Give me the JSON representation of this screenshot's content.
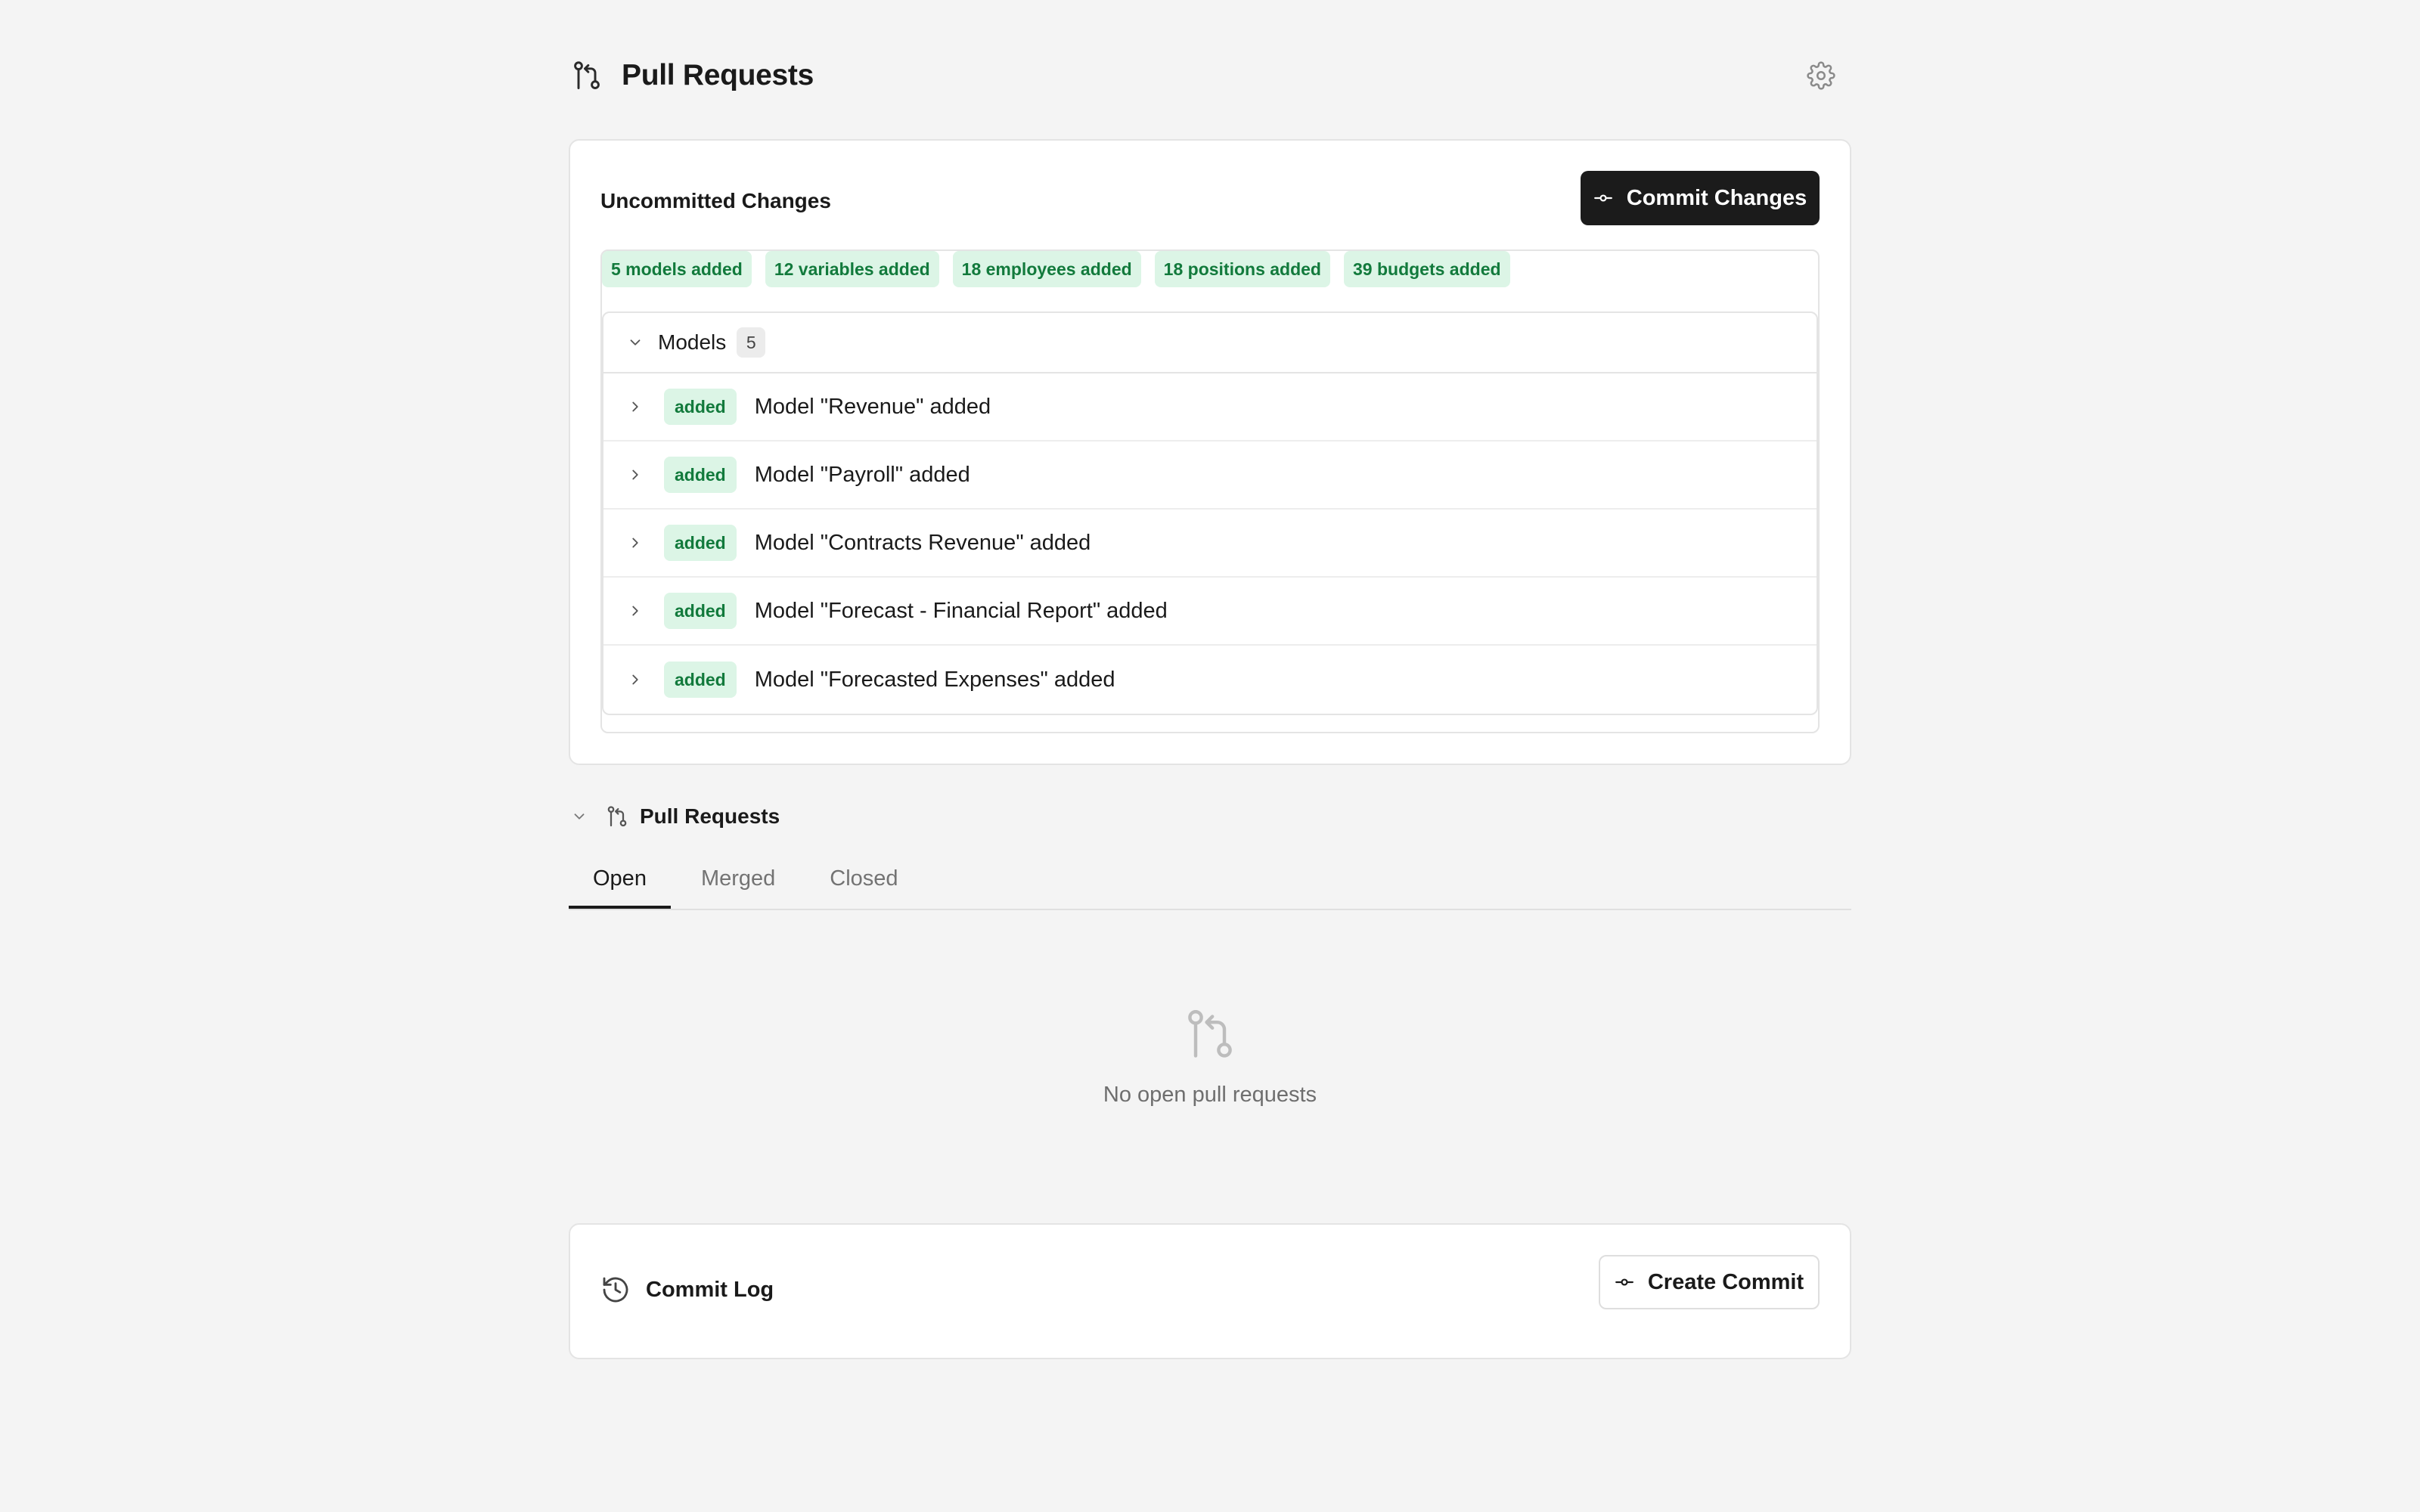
{
  "header": {
    "title": "Pull Requests",
    "icon": "git-pull-request-icon",
    "settings_icon": "gear-icon"
  },
  "uncommitted": {
    "title": "Uncommitted Changes",
    "commit_button_label": "Commit Changes",
    "summary_badges": [
      "5 models added",
      "12 variables added",
      "18 employees added",
      "18 positions added",
      "39 budgets added"
    ],
    "models_group": {
      "label": "Models",
      "count": "5",
      "rows": [
        {
          "status": "added",
          "text": "Model \"Revenue\" added"
        },
        {
          "status": "added",
          "text": "Model \"Payroll\" added"
        },
        {
          "status": "added",
          "text": "Model \"Contracts Revenue\" added"
        },
        {
          "status": "added",
          "text": "Model \"Forecast - Financial Report\" added"
        },
        {
          "status": "added",
          "text": "Model \"Forecasted Expenses\" added"
        }
      ]
    }
  },
  "pull_requests": {
    "title": "Pull Requests",
    "tabs": [
      {
        "label": "Open",
        "active": true
      },
      {
        "label": "Merged",
        "active": false
      },
      {
        "label": "Closed",
        "active": false
      }
    ],
    "empty_text": "No open pull requests"
  },
  "commit_log": {
    "title": "Commit Log",
    "create_button_label": "Create Commit",
    "icon": "history-icon"
  },
  "colors": {
    "background": "#f4f4f4",
    "added_bg": "#dcf5e6",
    "added_text": "#127a3c",
    "primary_button": "#1b1b1b"
  }
}
